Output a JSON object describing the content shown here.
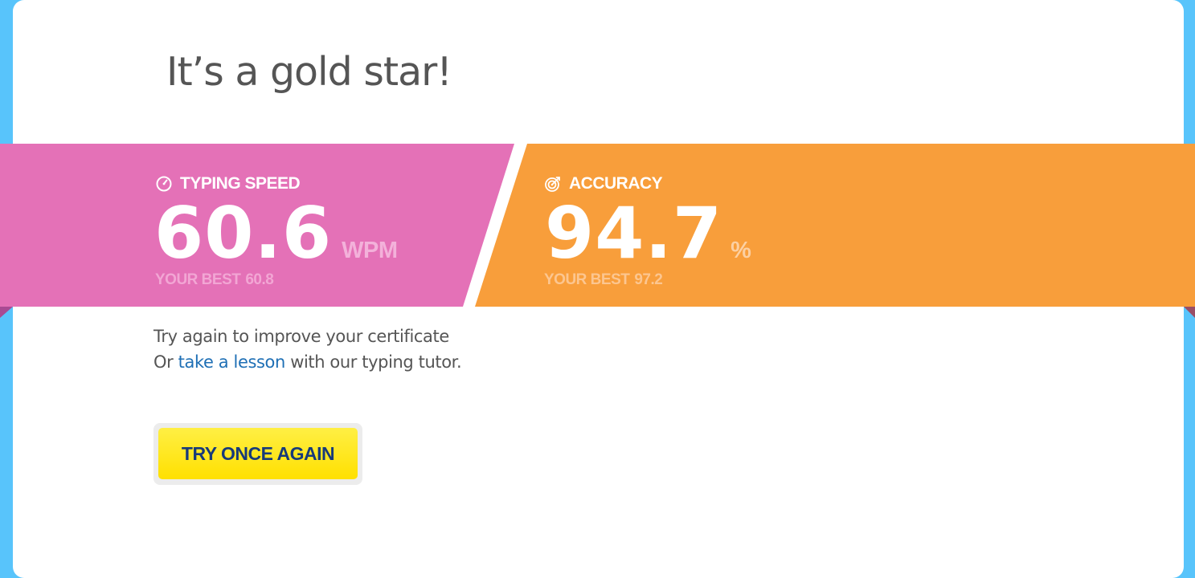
{
  "page": {
    "title": "It’s a gold star!"
  },
  "stats": {
    "speed": {
      "icon": "speedometer-icon",
      "label": "TYPING SPEED",
      "value": "60.6",
      "unit": "WPM",
      "best_label": "YOUR BEST",
      "best_value": "60.8"
    },
    "accuracy": {
      "icon": "target-icon",
      "label": "ACCURACY",
      "value": "94.7",
      "unit": "%",
      "best_label": "YOUR BEST",
      "best_value": "97.2"
    }
  },
  "message": {
    "line1": "Try again to improve your certificate",
    "line2_prefix": "Or",
    "link_text": "take a lesson",
    "line2_suffix": "with our typing tutor."
  },
  "actions": {
    "try_again_label": "TRY ONCE AGAIN"
  },
  "colors": {
    "background": "#58c4fb",
    "speed_panel": "#e471b7",
    "accuracy_panel": "#f89e3b",
    "button": "#ffe61a",
    "button_text": "#173a7a",
    "link": "#1e6fb5"
  }
}
